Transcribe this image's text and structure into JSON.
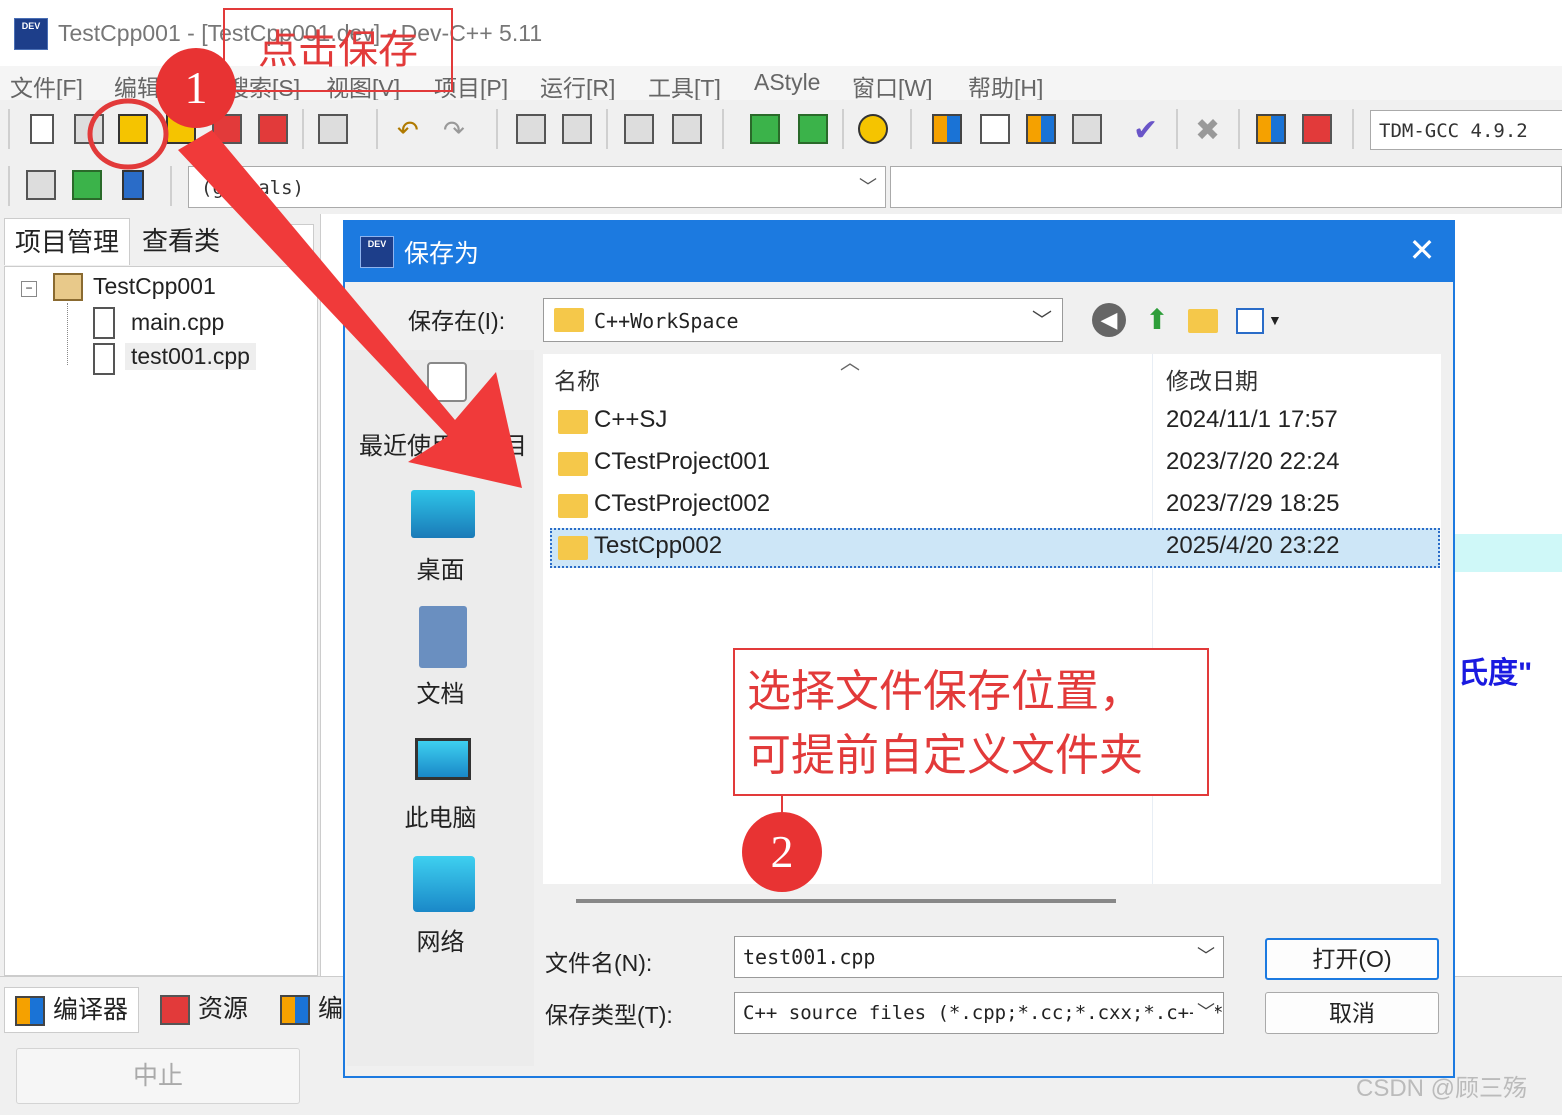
{
  "app": {
    "title": "TestCpp001 - [TestCpp001.dev] - Dev-C++ 5.11",
    "logo": "DEV"
  },
  "menu": [
    "文件[F]",
    "编辑",
    "搜索[S]",
    "视图[V]",
    "项目[P]",
    "运行[R]",
    "工具[T]",
    "AStyle",
    "窗口[W]",
    "帮助[H]"
  ],
  "toolbar": {
    "compiler": "TDM-GCC 4.9.2",
    "scope": "(globals)"
  },
  "left_panel": {
    "tabs": [
      "项目管理",
      "查看类"
    ],
    "project": "TestCpp001",
    "files": [
      "main.cpp",
      "test001.cpp"
    ]
  },
  "editor": {
    "fragment": "氏度\""
  },
  "bottom_panel": {
    "tabs": [
      "编译器",
      "资源",
      "编"
    ],
    "abort": "中止"
  },
  "dialog": {
    "title": "保存为",
    "close": "✕",
    "save_in_label": "保存在(I):",
    "folder": "C++WorkSpace",
    "places": [
      "最近使用的项目",
      "桌面",
      "文档",
      "此电脑",
      "网络"
    ],
    "columns": {
      "name": "名称",
      "date": "修改日期"
    },
    "rows": [
      {
        "name": "C++SJ",
        "date": "2024/11/1 17:57"
      },
      {
        "name": "CTestProject001",
        "date": "2023/7/20 22:24"
      },
      {
        "name": "CTestProject002",
        "date": "2023/7/29 18:25"
      },
      {
        "name": "TestCpp002",
        "date": "2025/4/20 23:22"
      }
    ],
    "filename_label": "文件名(N):",
    "filename": "test001.cpp",
    "filetype_label": "保存类型(T):",
    "filetype": "C++ source files (*.cpp;*.cc;*.cxx;*.c++;*.hpp;*.hh;*.h++)",
    "open": "打开(O)",
    "cancel": "取消"
  },
  "annotations": {
    "step1": "1",
    "step1_text": "点击保存",
    "step2": "2",
    "step2_line1": "选择文件保存位置，",
    "step2_line2": "可提前自定义文件夹"
  },
  "watermark": "CSDN @顾三殇",
  "colors": {
    "accent": "#1c7ae0",
    "annotation": "#e23a3a",
    "selection": "#cde6f7"
  }
}
